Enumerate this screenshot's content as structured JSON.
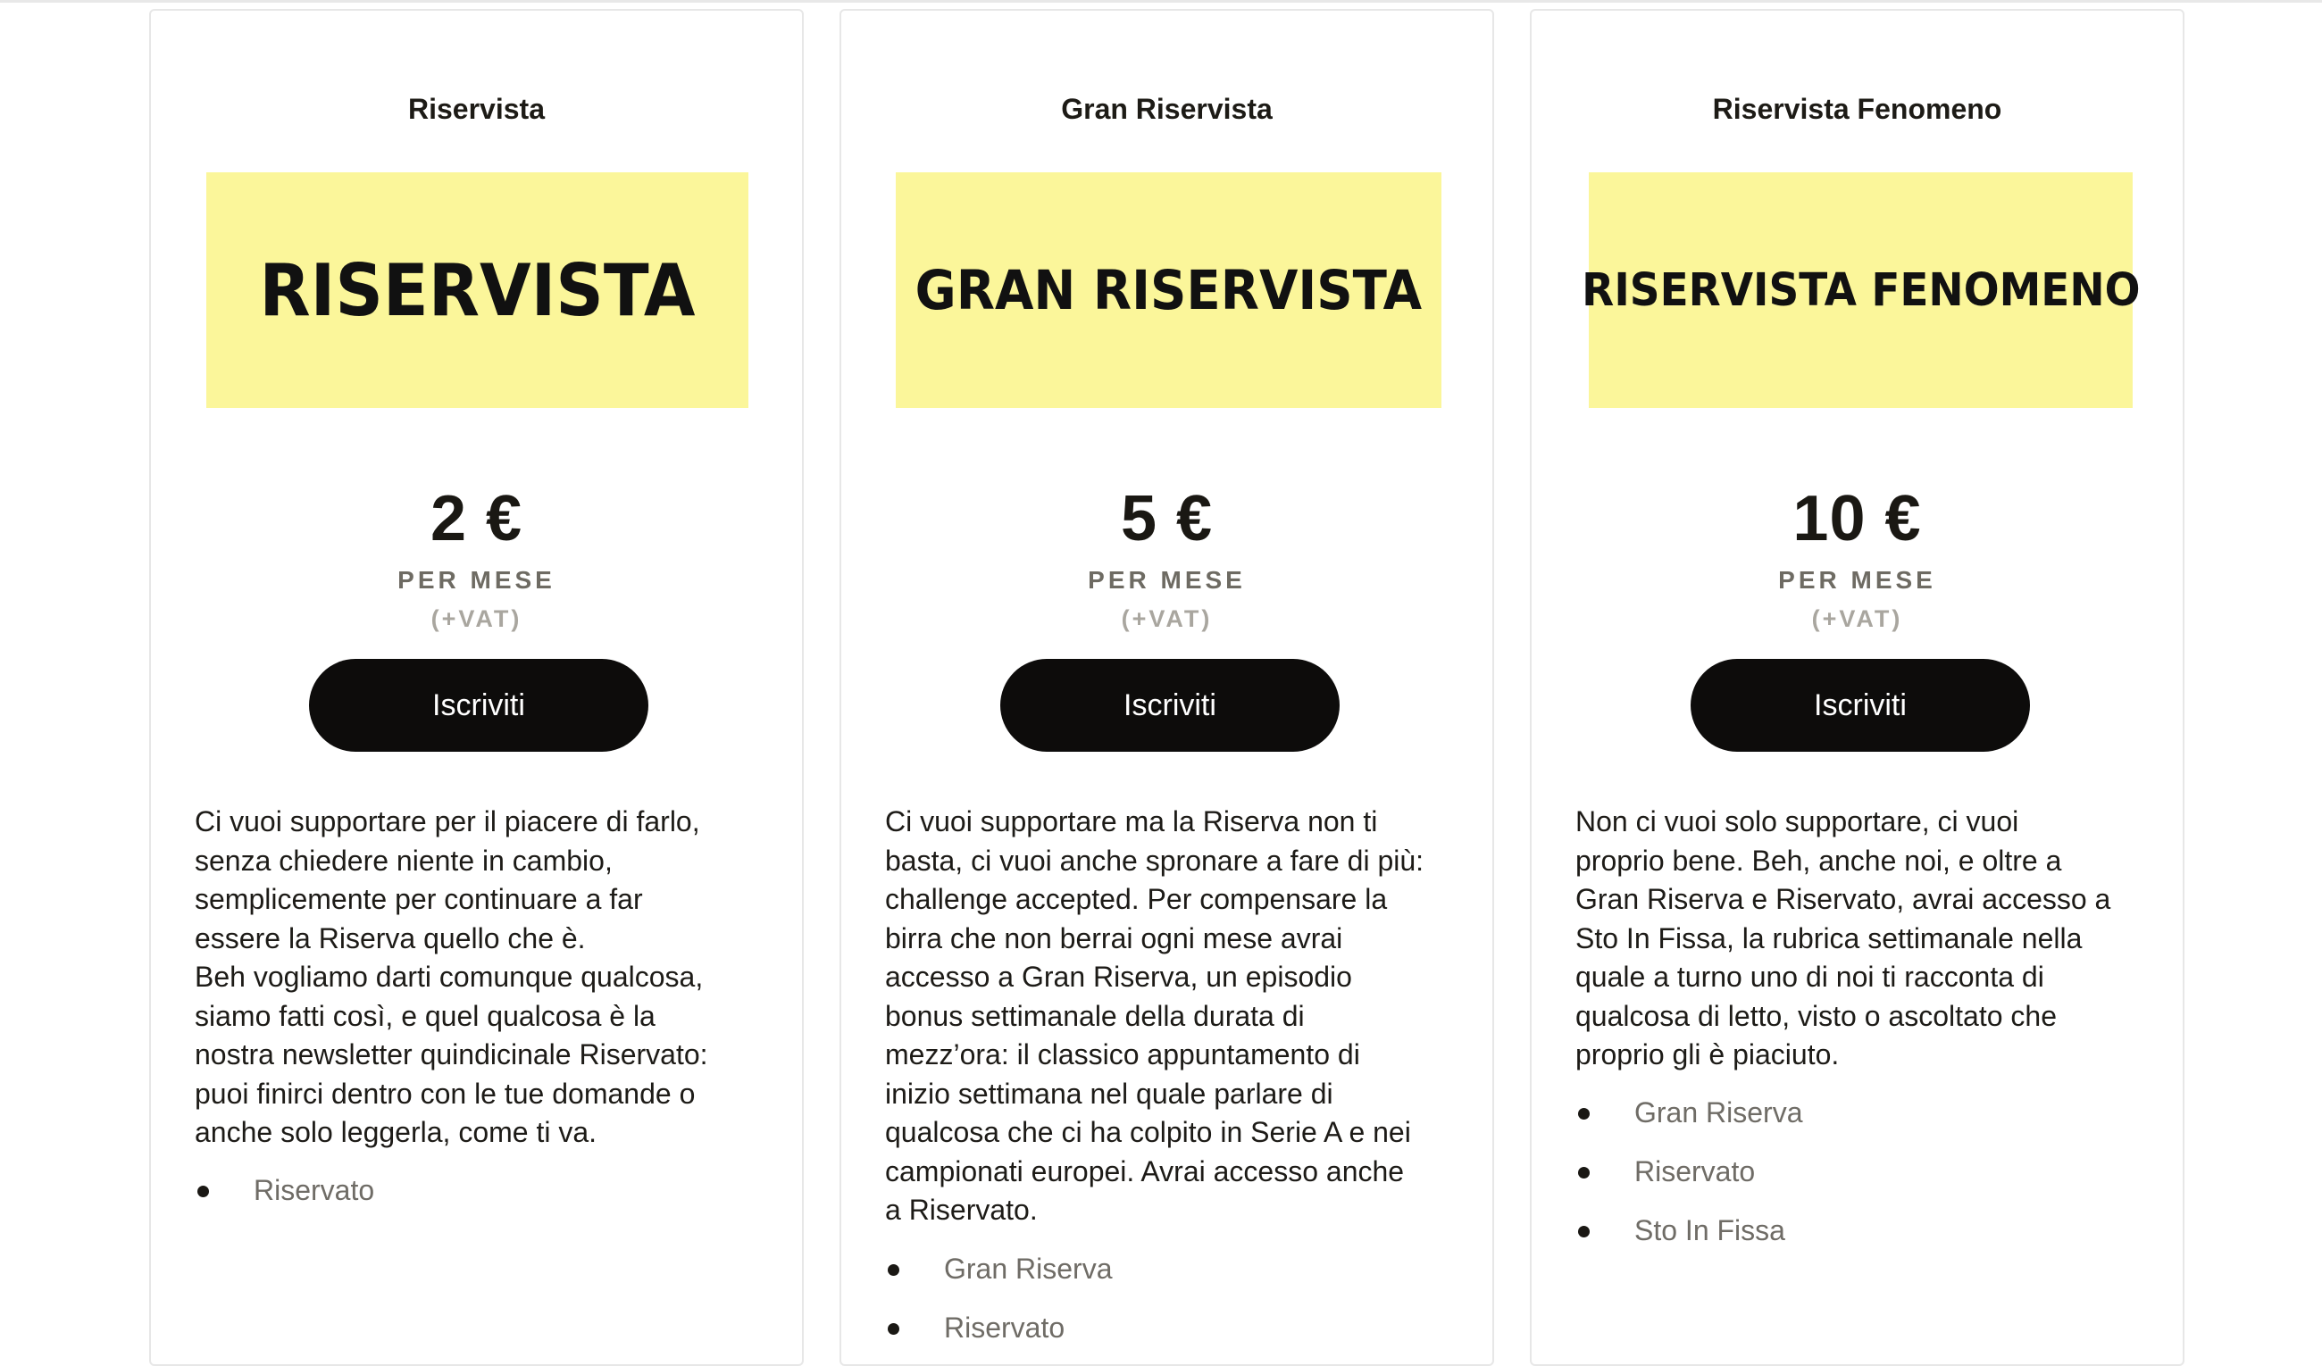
{
  "plans": [
    {
      "name": "Riservista",
      "banner_text": "RISERVISTA",
      "price": "2 €",
      "period": "PER MESE",
      "vat": "(+VAT)",
      "button_label": "Iscriviti",
      "description": [
        "Ci vuoi supportare per il piacere di farlo,",
        "senza chiedere niente in cambio,",
        "semplicemente per continuare a far",
        "essere la Riserva quello che è.",
        "Beh vogliamo darti comunque qualcosa,",
        "siamo fatti così, e quel qualcosa è la",
        "nostra newsletter quindicinale Riservato:",
        "puoi finirci dentro con le tue domande o",
        "anche solo leggerla, come ti va."
      ],
      "benefits": [
        "Riservato"
      ]
    },
    {
      "name": "Gran Riservista",
      "banner_text": "GRAN RISERVISTA",
      "price": "5 €",
      "period": "PER MESE",
      "vat": "(+VAT)",
      "button_label": "Iscriviti",
      "description": [
        "Ci vuoi supportare ma la Riserva non ti",
        "basta, ci vuoi anche spronare a fare di più:",
        "challenge accepted. Per compensare la",
        "birra che non berrai ogni mese avrai",
        "accesso a Gran Riserva, un episodio",
        "bonus settimanale della durata di",
        "mezz’ora: il classico appuntamento di",
        "inizio settimana nel quale parlare di",
        "qualcosa che ci ha colpito in Serie A e nei",
        "campionati europei. Avrai accesso anche",
        "a Riservato."
      ],
      "benefits": [
        "Gran Riserva",
        "Riservato"
      ]
    },
    {
      "name": "Riservista Fenomeno",
      "banner_text": "RISERVISTA FENOMENO",
      "price": "10 €",
      "period": "PER MESE",
      "vat": "(+VAT)",
      "button_label": "Iscriviti",
      "description": [
        "Non ci vuoi solo supportare, ci vuoi",
        "proprio bene. Beh, anche noi, e oltre a",
        "Gran Riserva e Riservato, avrai accesso a",
        "Sto In Fissa, la rubrica settimanale nella",
        "quale a turno uno di noi ti racconta di",
        "qualcosa di letto, visto o ascoltato che",
        "proprio gli è piaciuto."
      ],
      "benefits": [
        "Gran Riserva",
        "Riservato",
        "Sto In Fissa"
      ]
    }
  ],
  "colors": {
    "banner_background": "#fbf69a",
    "button_background": "#0d0c0b",
    "button_text": "#ffffff",
    "card_border": "#e7e7e7"
  },
  "icons": {
    "list_marker": "bullet-icon"
  }
}
